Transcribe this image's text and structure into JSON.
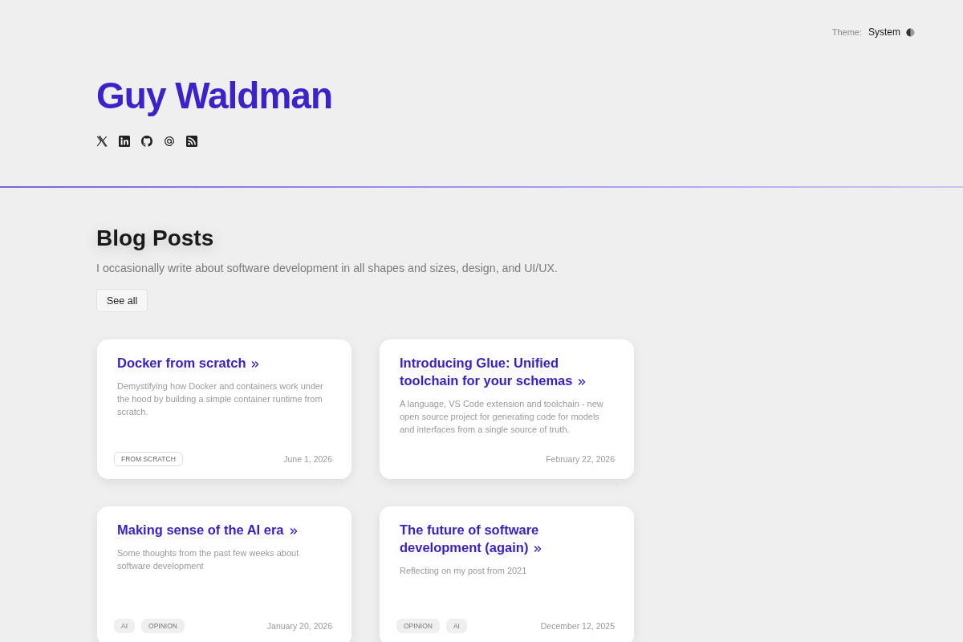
{
  "theme": {
    "label": "Theme:",
    "value": "System"
  },
  "header": {
    "name": "Guy Waldman",
    "social_links": [
      {
        "kind": "x"
      },
      {
        "kind": "linkedin"
      },
      {
        "kind": "github"
      },
      {
        "kind": "email"
      },
      {
        "kind": "rss"
      }
    ]
  },
  "blog": {
    "title": "Blog Posts",
    "description": "I occasionally write about software development in all shapes and sizes, design, and UI/UX.",
    "see_all": "See all",
    "posts": [
      {
        "title": "Docker from scratch",
        "summary": "Demystifying how Docker and containers work under the hood by building a simple container runtime from scratch.",
        "tags": [
          {
            "label": "FROM SCRATCH",
            "kind": "outlined"
          }
        ],
        "date": "June 1, 2026"
      },
      {
        "title": "Introducing Glue: Unified toolchain for your schemas",
        "summary": "A language, VS Code extension and toolchain - new open source project for generating code for models and interfaces from a single source of truth.",
        "date": "February 22, 2026"
      },
      {
        "title": "Making sense of the AI era",
        "summary": "Some thoughts from the past few weeks about software development",
        "tags": [
          {
            "label": "AI",
            "kind": "filled"
          },
          {
            "label": "OPINION",
            "kind": "filled"
          }
        ],
        "date": "January 20, 2026"
      },
      {
        "title": "The future of software development (again)",
        "summary": "Reflecting on my post from 2021",
        "tags": [
          {
            "label": "OPINION",
            "kind": "filled"
          },
          {
            "label": "AI",
            "kind": "filled"
          }
        ],
        "date": "December 12, 2025"
      }
    ]
  }
}
